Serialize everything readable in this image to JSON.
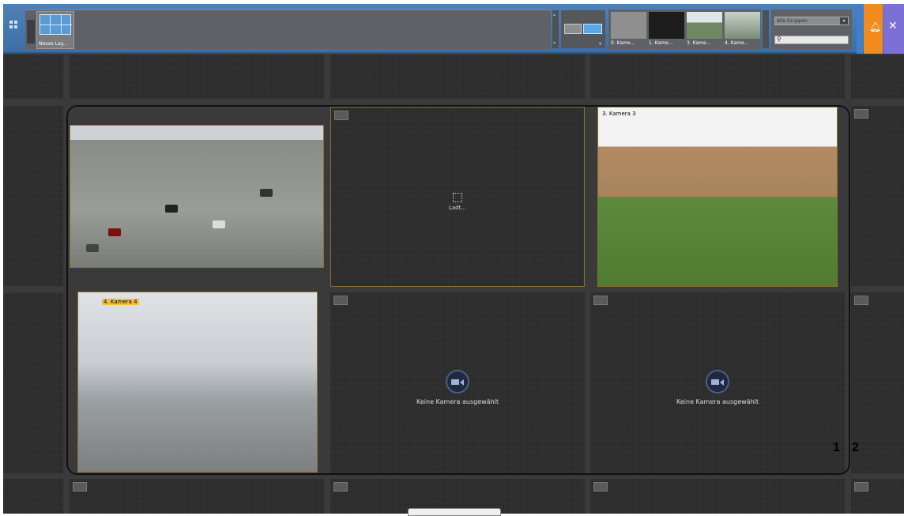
{
  "toolbar": {
    "layout_label": "Neues Lay...",
    "cameras": [
      {
        "label": "0. Kame...",
        "color": "#8f8f8f"
      },
      {
        "label": "1. Kame...",
        "color": "#1d1d1d"
      },
      {
        "label": "3. Kame...",
        "color": "#6f8a62"
      },
      {
        "label": "4. Kame...",
        "color": "#7c8b7a"
      }
    ],
    "group_select": "Alle Gruppen",
    "search_placeholder": ""
  },
  "tiles": {
    "loading_text": "Ladt...",
    "camera3_title": "3. Kamera 3",
    "camera4_title": "4. Kamera 4",
    "no_camera_text": "Keine Kamera ausgewählt"
  },
  "markers": {
    "one": "1",
    "two": "2"
  },
  "colors": {
    "accent_blue": "#4f81b7",
    "alarm": "#f28c1c",
    "tools": "#7c6fd6",
    "selection": "#8a7036"
  }
}
